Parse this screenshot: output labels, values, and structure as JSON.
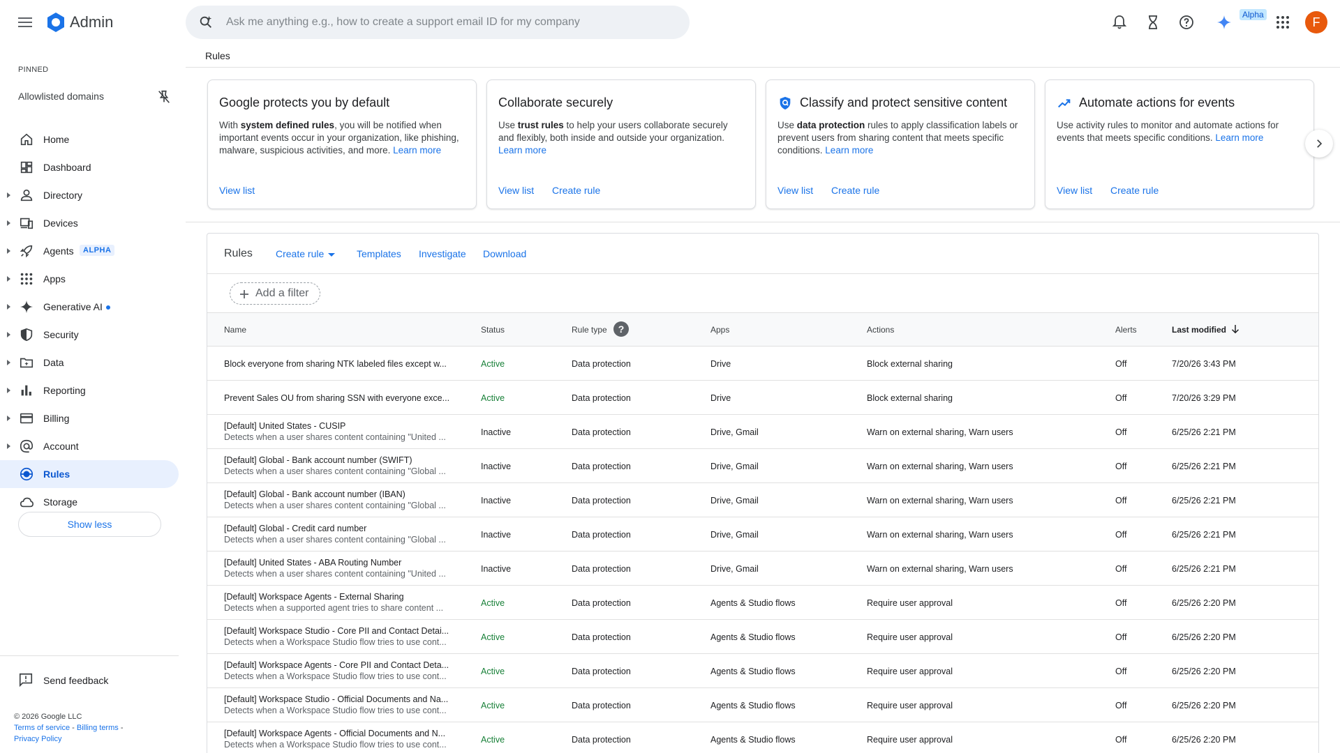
{
  "app": {
    "brand": "Admin",
    "search_placeholder": "Ask me anything e.g., how to create a support email ID for my company",
    "alpha_badge": "Alpha",
    "avatar_initial": "F"
  },
  "breadcrumb": {
    "title": "Rules"
  },
  "sidebar": {
    "pinned_label": "PINNED",
    "pinned_item": "Allowlisted domains",
    "items": [
      {
        "label": "Home",
        "icon": "home-icon",
        "caret": false
      },
      {
        "label": "Dashboard",
        "icon": "dashboard-icon",
        "caret": false
      },
      {
        "label": "Directory",
        "icon": "person-icon",
        "caret": true
      },
      {
        "label": "Devices",
        "icon": "devices-icon",
        "caret": true
      },
      {
        "label": "Agents",
        "icon": "rocket-icon",
        "caret": true,
        "badge": "ALPHA"
      },
      {
        "label": "Apps",
        "icon": "apps-grid-icon",
        "caret": true
      },
      {
        "label": "Generative AI",
        "icon": "sparkle-icon",
        "caret": true,
        "dot": true
      },
      {
        "label": "Security",
        "icon": "shield-icon",
        "caret": true
      },
      {
        "label": "Data",
        "icon": "folder-icon",
        "caret": true
      },
      {
        "label": "Reporting",
        "icon": "bar-chart-icon",
        "caret": true
      },
      {
        "label": "Billing",
        "icon": "credit-card-icon",
        "caret": true
      },
      {
        "label": "Account",
        "icon": "at-sign-icon",
        "caret": true
      },
      {
        "label": "Rules",
        "icon": "target-icon",
        "caret": false,
        "active": true
      },
      {
        "label": "Storage",
        "icon": "cloud-icon",
        "caret": false
      }
    ],
    "show_less": "Show less",
    "send_feedback": "Send feedback",
    "copyright": "© 2026 Google LLC",
    "terms": "Terms of service",
    "billing_terms": "Billing terms",
    "privacy": "Privacy Policy"
  },
  "cards": [
    {
      "title": "Google protects you by default",
      "icon": "",
      "body_pre": "With ",
      "body_bold": "system defined rules",
      "body_post": ", you will be notified when important events occur in your organization, like phishing, malware, suspicious activities, and more. ",
      "learn_more": "Learn more",
      "links": [
        "View list"
      ]
    },
    {
      "title": "Collaborate securely",
      "icon": "",
      "body_pre": "Use ",
      "body_bold": "trust rules",
      "body_post": " to help your users collaborate securely and flexibly, both inside and outside your organization. ",
      "learn_more": "Learn more",
      "links": [
        "View list",
        "Create rule"
      ]
    },
    {
      "title": "Classify and protect sensitive content",
      "icon": "shield-lock-icon",
      "body_pre": "Use ",
      "body_bold": "data protection",
      "body_post": " rules to apply classification labels or prevent users from sharing content that meets specific conditions. ",
      "learn_more": "Learn more",
      "links": [
        "View list",
        "Create rule"
      ]
    },
    {
      "title": "Automate actions for events",
      "icon": "trending-up-icon",
      "body_pre": "Use activity rules to monitor and automate actions for events that meets specific conditions. ",
      "body_bold": "",
      "body_post": "",
      "learn_more": "Learn more",
      "links": [
        "View list",
        "Create rule"
      ]
    }
  ],
  "rules": {
    "title": "Rules",
    "create_rule": "Create rule",
    "templates": "Templates",
    "investigate": "Investigate",
    "download": "Download",
    "add_filter": "Add a filter",
    "columns": {
      "name": "Name",
      "status": "Status",
      "rule_type": "Rule type",
      "apps": "Apps",
      "actions": "Actions",
      "alerts": "Alerts",
      "last_modified": "Last modified"
    },
    "rows": [
      {
        "name": "Block everyone from sharing NTK labeled files except w...",
        "desc": "",
        "status": "Active",
        "type": "Data protection",
        "apps": "Drive",
        "actions": "Block external sharing",
        "alerts": "Off",
        "modified": "7/20/26 3:43 PM"
      },
      {
        "name": "Prevent Sales OU from sharing SSN with everyone exce...",
        "desc": "",
        "status": "Active",
        "type": "Data protection",
        "apps": "Drive",
        "actions": "Block external sharing",
        "alerts": "Off",
        "modified": "7/20/26 3:29 PM"
      },
      {
        "name": "[Default] United States - CUSIP",
        "desc": "Detects when a user shares content containing \"United ...",
        "status": "Inactive",
        "type": "Data protection",
        "apps": "Drive, Gmail",
        "actions": "Warn on external sharing, Warn users",
        "alerts": "Off",
        "modified": "6/25/26 2:21 PM"
      },
      {
        "name": "[Default] Global - Bank account number (SWIFT)",
        "desc": "Detects when a user shares content containing \"Global ...",
        "status": "Inactive",
        "type": "Data protection",
        "apps": "Drive, Gmail",
        "actions": "Warn on external sharing, Warn users",
        "alerts": "Off",
        "modified": "6/25/26 2:21 PM"
      },
      {
        "name": "[Default] Global - Bank account number (IBAN)",
        "desc": "Detects when a user shares content containing \"Global ...",
        "status": "Inactive",
        "type": "Data protection",
        "apps": "Drive, Gmail",
        "actions": "Warn on external sharing, Warn users",
        "alerts": "Off",
        "modified": "6/25/26 2:21 PM"
      },
      {
        "name": "[Default] Global - Credit card number",
        "desc": "Detects when a user shares content containing \"Global ...",
        "status": "Inactive",
        "type": "Data protection",
        "apps": "Drive, Gmail",
        "actions": "Warn on external sharing, Warn users",
        "alerts": "Off",
        "modified": "6/25/26 2:21 PM"
      },
      {
        "name": "[Default] United States - ABA Routing Number",
        "desc": "Detects when a user shares content containing \"United ...",
        "status": "Inactive",
        "type": "Data protection",
        "apps": "Drive, Gmail",
        "actions": "Warn on external sharing, Warn users",
        "alerts": "Off",
        "modified": "6/25/26 2:21 PM"
      },
      {
        "name": "[Default] Workspace Agents - External Sharing",
        "desc": "Detects when a supported agent tries to share content ...",
        "status": "Active",
        "type": "Data protection",
        "apps": "Agents & Studio flows",
        "actions": "Require user approval",
        "alerts": "Off",
        "modified": "6/25/26 2:20 PM"
      },
      {
        "name": "[Default] Workspace Studio - Core PII and Contact Detai...",
        "desc": "Detects when a Workspace Studio flow tries to use cont...",
        "status": "Active",
        "type": "Data protection",
        "apps": "Agents & Studio flows",
        "actions": "Require user approval",
        "alerts": "Off",
        "modified": "6/25/26 2:20 PM"
      },
      {
        "name": "[Default] Workspace Agents - Core PII and Contact Deta...",
        "desc": "Detects when a Workspace Studio flow tries to use cont...",
        "status": "Active",
        "type": "Data protection",
        "apps": "Agents & Studio flows",
        "actions": "Require user approval",
        "alerts": "Off",
        "modified": "6/25/26 2:20 PM"
      },
      {
        "name": "[Default] Workspace Studio - Official Documents and Na...",
        "desc": "Detects when a Workspace Studio flow tries to use cont...",
        "status": "Active",
        "type": "Data protection",
        "apps": "Agents & Studio flows",
        "actions": "Require user approval",
        "alerts": "Off",
        "modified": "6/25/26 2:20 PM"
      },
      {
        "name": "[Default] Workspace Agents - Official Documents and N...",
        "desc": "Detects when a Workspace Studio flow tries to use cont...",
        "status": "Active",
        "type": "Data protection",
        "apps": "Agents & Studio flows",
        "actions": "Require user approval",
        "alerts": "Off",
        "modified": "6/25/26 2:20 PM"
      }
    ]
  }
}
